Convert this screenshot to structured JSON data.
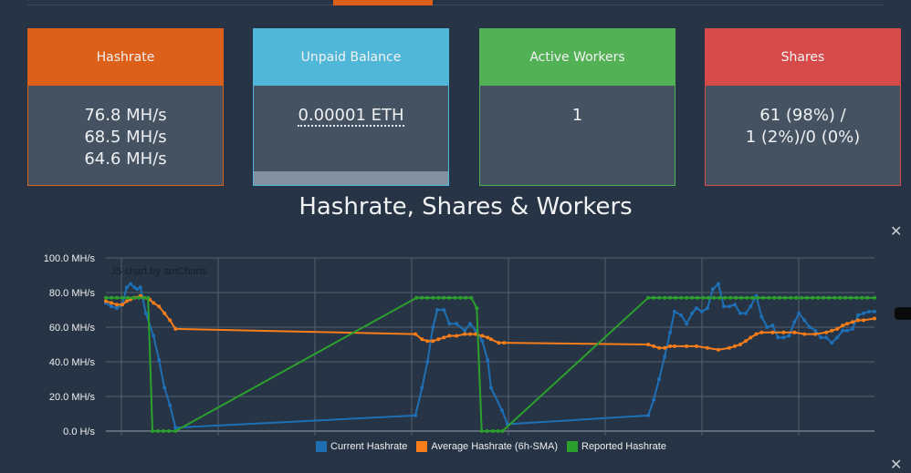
{
  "cards": {
    "hashrate": {
      "title": "Hashrate",
      "values": [
        "76.8 MH/s",
        "68.5 MH/s",
        "64.6 MH/s"
      ]
    },
    "unpaid": {
      "title": "Unpaid Balance",
      "value": "0.00001 ETH"
    },
    "workers": {
      "title": "Active Workers",
      "value": "1"
    },
    "shares": {
      "title": "Shares",
      "line1": "61 (98%) /",
      "line2": "1 (2%)/0 (0%)"
    }
  },
  "colors": {
    "hashrate": "#dc6019",
    "unpaid": "#50b7d9",
    "workers": "#52b055",
    "shares": "#d64a4a"
  },
  "chart_data": {
    "type": "line",
    "title": "Hashrate, Shares & Workers",
    "credit": "JS chart by amCharts",
    "xlabel": "",
    "ylabel": "",
    "xlim": [
      0,
      140.3
    ],
    "ylim": [
      0,
      100
    ],
    "yticks": [
      {
        "v": 0,
        "label": "0.0 H/s"
      },
      {
        "v": 20,
        "label": "20.0 MH/s"
      },
      {
        "v": 40,
        "label": "40.0 MH/s"
      },
      {
        "v": 60,
        "label": "60.0 MH/s"
      },
      {
        "v": 80,
        "label": "80.0 MH/s"
      },
      {
        "v": 100,
        "label": "100.0 MH/s"
      }
    ],
    "grid": true,
    "legend_position": "bottom",
    "series": [
      {
        "name": "Current Hashrate",
        "color": "#1f6fb5",
        "points": [
          [
            0,
            74
          ],
          [
            1,
            72
          ],
          [
            2,
            71
          ],
          [
            3,
            73
          ],
          [
            3.8,
            83
          ],
          [
            4.5,
            85
          ],
          [
            5.2,
            83
          ],
          [
            5.7,
            82
          ],
          [
            6.3,
            83
          ],
          [
            7.3,
            68
          ],
          [
            8.7,
            55
          ],
          [
            9.7,
            41
          ],
          [
            10.7,
            25
          ],
          [
            11.7,
            15
          ],
          [
            12.7,
            2
          ],
          [
            56.5,
            9
          ],
          [
            57.7,
            25
          ],
          [
            58.7,
            40
          ],
          [
            59.7,
            60
          ],
          [
            60.5,
            70
          ],
          [
            61.7,
            70
          ],
          [
            62.7,
            62
          ],
          [
            64,
            62
          ],
          [
            65.5,
            58
          ],
          [
            66.5,
            62
          ],
          [
            67.5,
            58
          ],
          [
            68.7,
            52
          ],
          [
            69.7,
            41
          ],
          [
            70.3,
            25
          ],
          [
            72.3,
            12
          ],
          [
            73.3,
            4
          ],
          [
            99,
            9
          ],
          [
            100,
            18
          ],
          [
            101,
            30
          ],
          [
            102,
            43
          ],
          [
            103,
            57
          ],
          [
            103.8,
            69
          ],
          [
            105,
            67
          ],
          [
            106,
            62
          ],
          [
            107,
            68
          ],
          [
            107.8,
            71
          ],
          [
            108.8,
            69
          ],
          [
            109.8,
            71
          ],
          [
            110.8,
            82
          ],
          [
            111.8,
            85
          ],
          [
            112.8,
            72
          ],
          [
            113.8,
            72
          ],
          [
            114.8,
            73
          ],
          [
            115.8,
            68
          ],
          [
            116.8,
            68
          ],
          [
            117.7,
            72
          ],
          [
            118.7,
            78
          ],
          [
            119.7,
            66
          ],
          [
            120.7,
            60
          ],
          [
            121.7,
            61
          ],
          [
            122.7,
            54
          ],
          [
            123.7,
            54
          ],
          [
            124.7,
            55
          ],
          [
            125.7,
            63
          ],
          [
            126.5,
            68
          ],
          [
            127.5,
            64
          ],
          [
            128.5,
            60
          ],
          [
            129.5,
            58
          ],
          [
            130.5,
            54
          ],
          [
            131.5,
            54
          ],
          [
            132.5,
            51
          ],
          [
            133.5,
            54
          ],
          [
            134.5,
            58
          ],
          [
            135.3,
            58
          ],
          [
            136.3,
            59
          ],
          [
            137.3,
            67
          ],
          [
            138.3,
            68
          ],
          [
            139.3,
            69
          ],
          [
            140.3,
            69
          ]
        ]
      },
      {
        "name": "Average Hashrate (6h-SMA)",
        "color": "#f77d1a",
        "points": [
          [
            0,
            75
          ],
          [
            1,
            74
          ],
          [
            2,
            73
          ],
          [
            3,
            73
          ],
          [
            3.8,
            75
          ],
          [
            4.5,
            76
          ],
          [
            5.2,
            77
          ],
          [
            6.3,
            78
          ],
          [
            7,
            77
          ],
          [
            8,
            76
          ],
          [
            8.7,
            74
          ],
          [
            9.7,
            72
          ],
          [
            10.7,
            68
          ],
          [
            11.7,
            64
          ],
          [
            12.7,
            59
          ],
          [
            56.5,
            56
          ],
          [
            57.7,
            53
          ],
          [
            58.7,
            52
          ],
          [
            59.7,
            52
          ],
          [
            60.7,
            53
          ],
          [
            61.7,
            54
          ],
          [
            62.7,
            55
          ],
          [
            64,
            55
          ],
          [
            65.5,
            56
          ],
          [
            66.5,
            56
          ],
          [
            67.5,
            56
          ],
          [
            68.7,
            55
          ],
          [
            69.7,
            54
          ],
          [
            70.3,
            53
          ],
          [
            71.7,
            51
          ],
          [
            72.7,
            51
          ],
          [
            99,
            50
          ],
          [
            100,
            49
          ],
          [
            101,
            48
          ],
          [
            102,
            48
          ],
          [
            103,
            49
          ],
          [
            103.8,
            49
          ],
          [
            106,
            49
          ],
          [
            107.8,
            49
          ],
          [
            109.8,
            48
          ],
          [
            111.8,
            47
          ],
          [
            113.8,
            48
          ],
          [
            114.8,
            49
          ],
          [
            115.8,
            50
          ],
          [
            116.8,
            52
          ],
          [
            117.7,
            54
          ],
          [
            118.7,
            56
          ],
          [
            119.7,
            57
          ],
          [
            121.7,
            57
          ],
          [
            123.7,
            57
          ],
          [
            125.7,
            57
          ],
          [
            127.5,
            56
          ],
          [
            129.5,
            56
          ],
          [
            131.5,
            57
          ],
          [
            132.5,
            58
          ],
          [
            133.5,
            59
          ],
          [
            134.5,
            61
          ],
          [
            135.3,
            62
          ],
          [
            136.3,
            63
          ],
          [
            137.3,
            64
          ],
          [
            138.3,
            64
          ],
          [
            140.3,
            65
          ]
        ]
      },
      {
        "name": "Reported Hashrate",
        "color": "#2ca02c",
        "points": [
          [
            0,
            77
          ],
          [
            1,
            77
          ],
          [
            2,
            77
          ],
          [
            3,
            77
          ],
          [
            4,
            77
          ],
          [
            5,
            77
          ],
          [
            6,
            77
          ],
          [
            7,
            77
          ],
          [
            7.7,
            77
          ],
          [
            8.5,
            0
          ],
          [
            9.5,
            0
          ],
          [
            10.5,
            0
          ],
          [
            11.5,
            0
          ],
          [
            12.7,
            0
          ],
          [
            56.7,
            77
          ],
          [
            57.7,
            77
          ],
          [
            58.7,
            77
          ],
          [
            59.7,
            77
          ],
          [
            60.7,
            77
          ],
          [
            61.7,
            77
          ],
          [
            62.7,
            77
          ],
          [
            63.7,
            77
          ],
          [
            64.7,
            77
          ],
          [
            65.7,
            77
          ],
          [
            66.7,
            77
          ],
          [
            67.7,
            71
          ],
          [
            68.6,
            0
          ],
          [
            69.6,
            0
          ],
          [
            70.6,
            0
          ],
          [
            71.6,
            0
          ],
          [
            72.4,
            0
          ],
          [
            99,
            77
          ],
          [
            100,
            77
          ],
          [
            101,
            77
          ],
          [
            102,
            77
          ],
          [
            103,
            77
          ],
          [
            104,
            77
          ],
          [
            105,
            77
          ],
          [
            106,
            77
          ],
          [
            107,
            77
          ],
          [
            108,
            77
          ],
          [
            109,
            77
          ],
          [
            110,
            77
          ],
          [
            111,
            77
          ],
          [
            112,
            77
          ],
          [
            113,
            77
          ],
          [
            114,
            77
          ],
          [
            115,
            77
          ],
          [
            116,
            77
          ],
          [
            117,
            77
          ],
          [
            118,
            77
          ],
          [
            119,
            77
          ],
          [
            120,
            77
          ],
          [
            121,
            77
          ],
          [
            122,
            77
          ],
          [
            123,
            77
          ],
          [
            124,
            77
          ],
          [
            125,
            77
          ],
          [
            126,
            77
          ],
          [
            127,
            77
          ],
          [
            128,
            77
          ],
          [
            129,
            77
          ],
          [
            130,
            77
          ],
          [
            131,
            77
          ],
          [
            132,
            77
          ],
          [
            133,
            77
          ],
          [
            134,
            77
          ],
          [
            135,
            77
          ],
          [
            136,
            77
          ],
          [
            137,
            77
          ],
          [
            138,
            77
          ],
          [
            139,
            77
          ],
          [
            140.3,
            77
          ]
        ]
      }
    ]
  }
}
